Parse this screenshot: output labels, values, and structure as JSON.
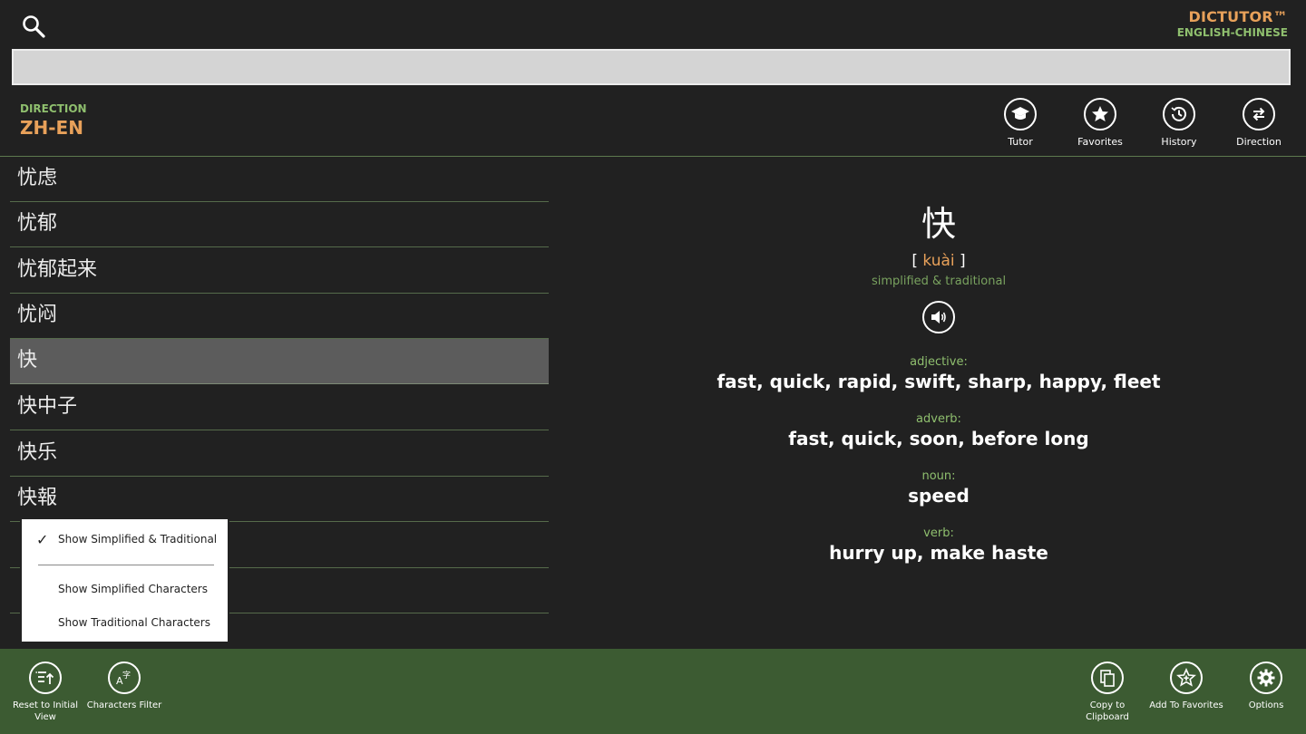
{
  "app": {
    "name": "DICTUTOR™",
    "subtitle": "ENGLISH-CHINESE"
  },
  "search": {
    "value": "",
    "placeholder": ""
  },
  "direction": {
    "label": "DIRECTION",
    "value": "ZH-EN"
  },
  "top_buttons": [
    {
      "label": "Tutor",
      "icon": "graduation-cap-icon"
    },
    {
      "label": "Favorites",
      "icon": "star-icon"
    },
    {
      "label": "History",
      "icon": "clock-history-icon"
    },
    {
      "label": "Direction",
      "icon": "swap-arrows-icon"
    }
  ],
  "word_list": [
    "忧虑",
    "忧郁",
    "忧郁起来",
    "忧闷",
    "快",
    "快中子",
    "快乐",
    "快報",
    "",
    "",
    ""
  ],
  "selected_index": 4,
  "entry": {
    "headword": "快",
    "pinyin_open": "[",
    "pinyin": "kuài",
    "pinyin_close": "]",
    "script_note": "simplified & traditional",
    "senses": [
      {
        "pos": "adjective:",
        "meaning": "fast, quick, rapid, swift, sharp, happy, fleet"
      },
      {
        "pos": "adverb:",
        "meaning": "fast, quick, soon, before long"
      },
      {
        "pos": "noun:",
        "meaning": "speed"
      },
      {
        "pos": "verb:",
        "meaning": "hurry up, make haste"
      }
    ]
  },
  "popup_menu": {
    "checked_index": 0,
    "options": [
      "Show Simplified & Traditional",
      "Show Simplified Characters",
      "Show Traditional Characters"
    ]
  },
  "app_bar": {
    "left": [
      {
        "label": "Reset to Initial View",
        "icon": "reset-list-icon"
      },
      {
        "label": "Characters Filter",
        "icon": "characters-filter-icon"
      }
    ],
    "right": [
      {
        "label": "Copy to Clipboard",
        "icon": "copy-icon"
      },
      {
        "label": "Add To Favorites",
        "icon": "add-favorite-icon"
      },
      {
        "label": "Options",
        "icon": "gear-icon"
      }
    ]
  },
  "colors": {
    "background": "#212121",
    "accent_orange": "#e8a15a",
    "accent_green": "#8fbf6e",
    "app_bar": "#3c5b32",
    "selected_row": "#5c5c5c"
  }
}
